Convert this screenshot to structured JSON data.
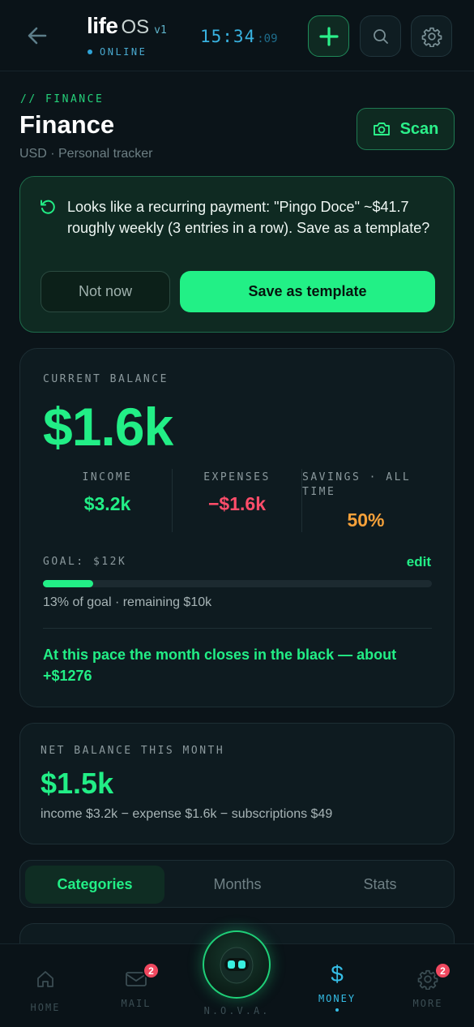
{
  "header": {
    "brand_main": "life",
    "brand_os": "OS",
    "brand_version": "v1",
    "status": "ONLINE",
    "clock_main": "15:34",
    "clock_seconds": ":09"
  },
  "page": {
    "section_tag": "// FINANCE",
    "title": "Finance",
    "subtitle": "USD · Personal tracker",
    "scan_label": "Scan"
  },
  "recurring": {
    "message": "Looks like a recurring payment: \"Pingo Doce\" ~$41.7 roughly weekly (3 entries in a row). Save as a template?",
    "dismiss_label": "Not now",
    "save_label": "Save as template"
  },
  "balance": {
    "label": "CURRENT BALANCE",
    "value": "$1.6k",
    "income_label": "INCOME",
    "income_value": "$3.2k",
    "expenses_label": "EXPENSES",
    "expenses_value": "−$1.6k",
    "savings_label": "SAVINGS · ALL TIME",
    "savings_value": "50%",
    "goal_label": "GOAL: $12K",
    "goal_edit": "edit",
    "goal_progress": 0.13,
    "goal_note": "13% of goal · remaining $10k",
    "pace_note": "At this pace the month closes in the black — about +$1276"
  },
  "net": {
    "label": "NET BALANCE THIS MONTH",
    "value": "$1.5k",
    "detail": "income $3.2k − expense $1.6k − subscriptions $49"
  },
  "tabs": [
    {
      "label": "Categories",
      "active": true
    },
    {
      "label": "Months",
      "active": false
    },
    {
      "label": "Stats",
      "active": false
    }
  ],
  "bottom_nav": {
    "home": "HOME",
    "mail": "MAIL",
    "mail_badge": "2",
    "nova": "N.O.V.A.",
    "money": "MONEY",
    "more": "MORE",
    "more_badge": "2"
  },
  "colors": {
    "accent_green": "#22ee86",
    "accent_blue": "#35bde6",
    "expense_red": "#ff4d6a",
    "savings_orange": "#f6a13a",
    "background": "#0b1419"
  }
}
